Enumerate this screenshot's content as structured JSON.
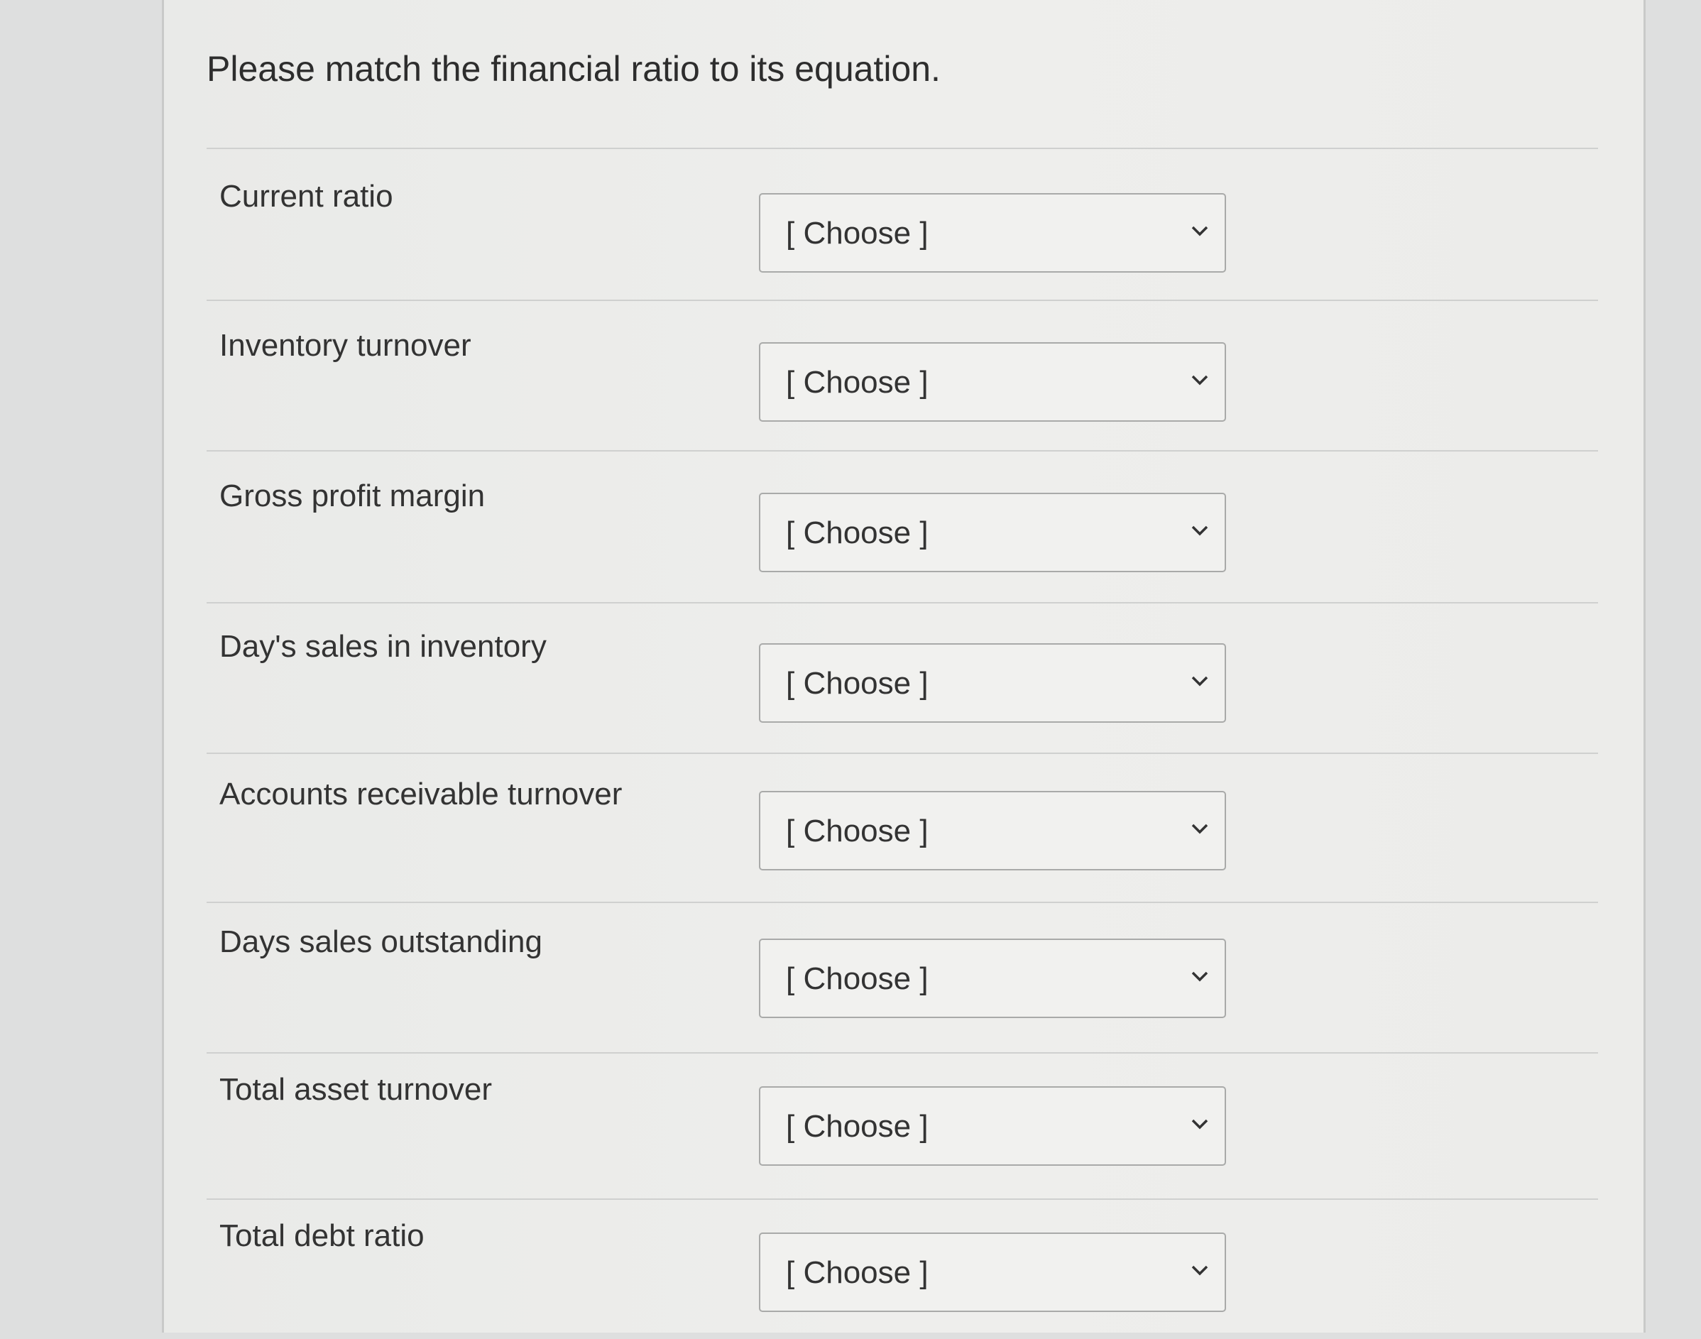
{
  "question": {
    "title": "Please match the financial ratio to its equation."
  },
  "rows": [
    {
      "label": "Current ratio",
      "selected": "[ Choose ]"
    },
    {
      "label": "Inventory turnover",
      "selected": "[ Choose ]"
    },
    {
      "label": "Gross profit margin",
      "selected": "[ Choose ]"
    },
    {
      "label": "Day's sales in inventory",
      "selected": "[ Choose ]"
    },
    {
      "label": "Accounts receivable turnover",
      "selected": "[ Choose ]"
    },
    {
      "label": "Days sales outstanding",
      "selected": "[ Choose ]"
    },
    {
      "label": "Total asset turnover",
      "selected": "[ Choose ]"
    },
    {
      "label": "Total debt ratio",
      "selected": "[ Choose ]"
    }
  ],
  "icons": {
    "dropdown": "chevron-down-icon"
  }
}
